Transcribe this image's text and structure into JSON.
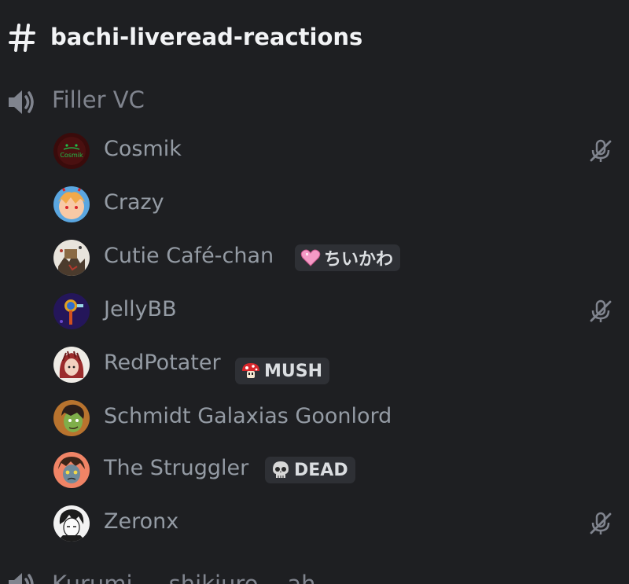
{
  "text_channel": {
    "icon": "hash-icon",
    "name": "bachi-liveread-reactions"
  },
  "voice_channel": {
    "icon": "speaker-icon",
    "name": "Filler VC",
    "members": [
      {
        "name": "Cosmik",
        "muted": true,
        "tag": null
      },
      {
        "name": "Crazy",
        "muted": false,
        "tag": null
      },
      {
        "name": "Cutie Café-chan",
        "muted": false,
        "tag": {
          "icon": "pink-heart-icon",
          "label": "ちいかわ"
        }
      },
      {
        "name": "JellyBB",
        "muted": true,
        "tag": null
      },
      {
        "name": "RedPotater",
        "muted": false,
        "tag": {
          "icon": "red-mushroom-icon",
          "label": "MUSH"
        }
      },
      {
        "name": "Schmidt Galaxias Goonlord",
        "muted": false,
        "tag": null
      },
      {
        "name": "The Struggler",
        "muted": false,
        "tag": {
          "icon": "skull-icon",
          "label": "DEAD"
        }
      },
      {
        "name": "Zeronx",
        "muted": true,
        "tag": null
      }
    ]
  },
  "next_voice_channel": {
    "icon": "speaker-icon",
    "name": "Kurumi ... shikiuro ...ah"
  },
  "colors": {
    "background": "#1e1f22",
    "channel_text": "#f2f3f5",
    "muted_text": "#949ba4",
    "tag_background": "#2e3035"
  }
}
